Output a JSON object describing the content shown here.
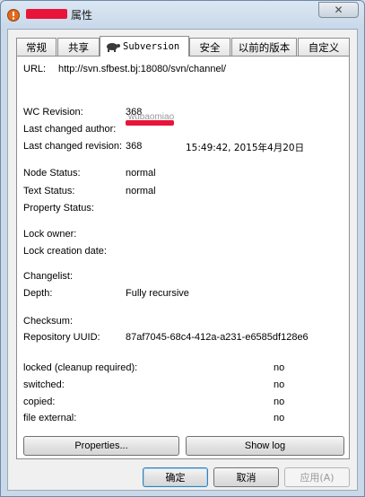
{
  "window": {
    "title": "属性"
  },
  "tabs": [
    {
      "label": "常规"
    },
    {
      "label": "共享"
    },
    {
      "label": "Subversion"
    },
    {
      "label": "安全"
    },
    {
      "label": "以前的版本"
    },
    {
      "label": "自定义"
    }
  ],
  "svn": {
    "url_label": "URL:",
    "url_value": "http://svn.sfbest.bj:18080/svn/channel/",
    "wc_revision_label": "WC Revision:",
    "wc_revision_value": "368",
    "last_changed_author_label": "Last changed author:",
    "last_changed_author_value": "wubaomiao",
    "last_changed_revision_label": "Last changed revision:",
    "last_changed_revision_value": "368",
    "last_changed_date_value": "15:49:42, 2015年4月20日",
    "node_status_label": "Node Status:",
    "node_status_value": "normal",
    "text_status_label": "Text Status:",
    "text_status_value": "normal",
    "property_status_label": "Property Status:",
    "lock_owner_label": "Lock owner:",
    "lock_creation_date_label": "Lock creation date:",
    "changelist_label": "Changelist:",
    "depth_label": "Depth:",
    "depth_value": "Fully recursive",
    "checksum_label": "Checksum:",
    "repository_uuid_label": "Repository UUID:",
    "repository_uuid_value": "87af7045-68c4-412a-a231-e6585df128e6",
    "locked_label": "locked (cleanup required):",
    "locked_value": "no",
    "switched_label": "switched:",
    "switched_value": "no",
    "copied_label": "copied:",
    "copied_value": "no",
    "file_external_label": "file external:",
    "file_external_value": "no"
  },
  "buttons": {
    "properties": "Properties...",
    "show_log": "Show log",
    "ok": "确定",
    "cancel": "取消",
    "apply": "应用(A)"
  },
  "colors": {
    "redaction": "#e8143a",
    "page_bg": "#ffffff",
    "dialog_bg": "#f0f0f0"
  },
  "icons": {
    "app": "warning-icon",
    "tab": "turtle-icon",
    "close": "close-icon"
  }
}
